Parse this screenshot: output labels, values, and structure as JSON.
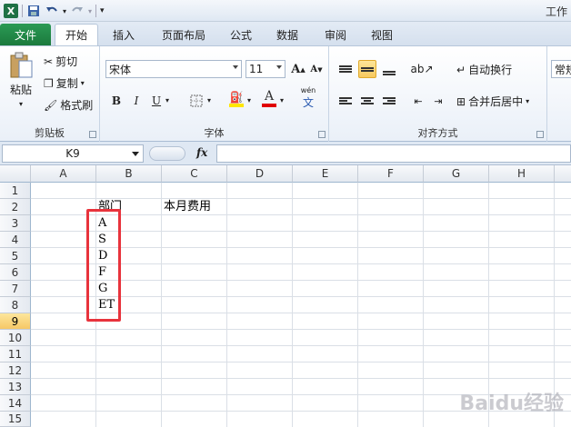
{
  "window": {
    "title": "工作"
  },
  "tabs": [
    {
      "label": "文件"
    },
    {
      "label": "开始"
    },
    {
      "label": "插入"
    },
    {
      "label": "页面布局"
    },
    {
      "label": "公式"
    },
    {
      "label": "数据"
    },
    {
      "label": "审阅"
    },
    {
      "label": "视图"
    }
  ],
  "clipboard": {
    "paste": "粘贴",
    "cut": "剪切",
    "copy": "复制",
    "format_painter": "格式刷",
    "label": "剪贴板"
  },
  "font": {
    "name": "宋体",
    "size": "11",
    "label": "字体",
    "bold": "B",
    "italic": "I",
    "underline": "U",
    "font_color_letter": "A",
    "grow": "A",
    "shrink": "A",
    "phonetic": "wén"
  },
  "alignment": {
    "wrap": "自动换行",
    "merge": "合并后居中",
    "label": "对齐方式"
  },
  "number": {
    "format": "常规"
  },
  "formula_bar": {
    "name_box": "K9",
    "fx": "fx",
    "value": ""
  },
  "columns": [
    "A",
    "B",
    "C",
    "D",
    "E",
    "F",
    "G",
    "H"
  ],
  "rows": [
    "1",
    "2",
    "3",
    "4",
    "5",
    "6",
    "7",
    "8",
    "9",
    "10",
    "11",
    "12",
    "13",
    "14",
    "15"
  ],
  "selected_row": "9",
  "cells": {
    "B2": "部门",
    "C2": "本月费用",
    "B3": "A",
    "B4": "S",
    "B5": "D",
    "B6": "F",
    "B7": "G",
    "B8": "ET"
  },
  "watermark": "Baidu经验",
  "colors": {
    "accent_green": "#1e7145",
    "highlight_red": "#e8333c",
    "selected_row": "#f6c766"
  }
}
